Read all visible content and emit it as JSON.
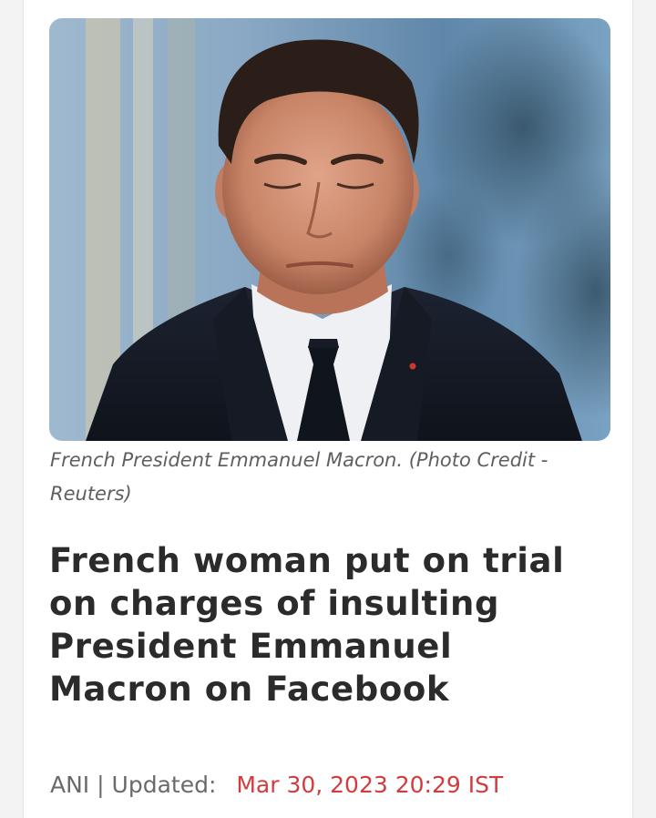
{
  "article": {
    "image_alt": "French President Emmanuel Macron",
    "caption": "French President Emmanuel Macron. (Photo Credit - Reuters)",
    "headline": "French woman put on trial on charges of insulting President Emmanuel Macron on Facebook",
    "source": "ANI",
    "separator": "|",
    "updated_label": "Updated:",
    "updated_date": "Mar 30, 2023 20:29 IST",
    "date_color": "#d23c3c"
  }
}
